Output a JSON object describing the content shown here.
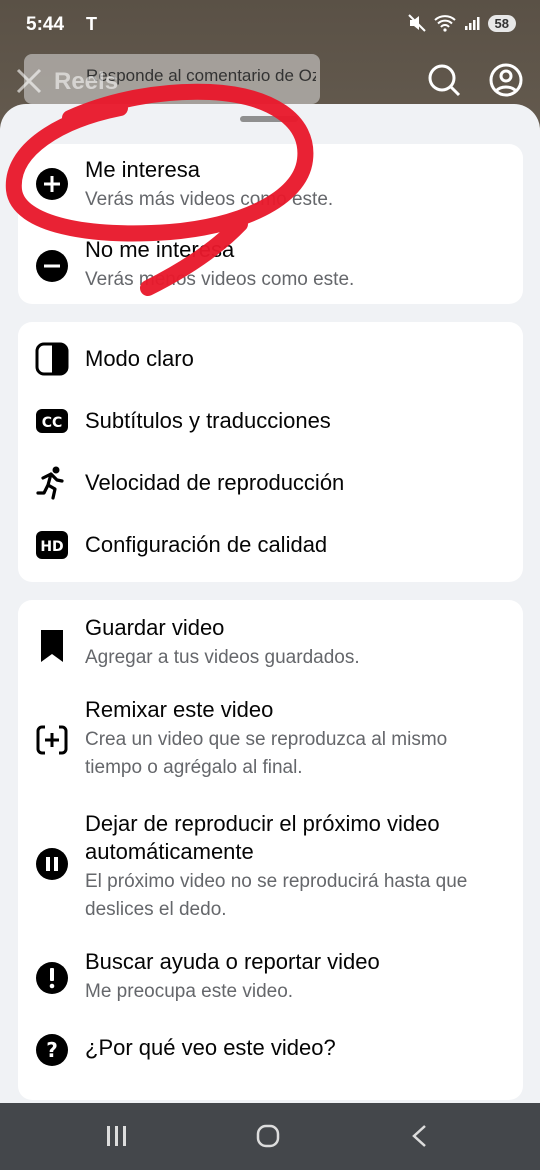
{
  "status": {
    "time": "5:44",
    "carrier_icon": "tesla-logo",
    "battery": "58"
  },
  "topbar": {
    "title": "Reels",
    "comment": "Responde al comentario de Ozcan Martinez"
  },
  "card1": [
    {
      "title": "Me interesa",
      "sub": "Verás más videos como este.",
      "icon": "plus-circle-icon"
    },
    {
      "title": "No me interesa",
      "sub": "Verás menos videos como este.",
      "icon": "minus-circle-icon"
    }
  ],
  "card2": [
    {
      "title": "Modo claro",
      "icon": "half-contrast-icon"
    },
    {
      "title": "Subtítulos y traducciones",
      "icon": "cc-icon"
    },
    {
      "title": "Velocidad de reproducción",
      "icon": "running-icon"
    },
    {
      "title": "Configuración de calidad",
      "icon": "hd-icon"
    }
  ],
  "card3": [
    {
      "title": "Guardar video",
      "sub": "Agregar a tus videos guardados.",
      "icon": "bookmark-icon"
    },
    {
      "title": "Remixar este video",
      "sub1": "Crea un video que se reproduzca al mismo",
      "sub2": "tiempo o agrégalo al final.",
      "icon": "remix-icon"
    },
    {
      "title1": "Dejar de reproducir el próximo video",
      "title2": "automáticamente",
      "sub1": "El próximo video no se reproducirá hasta que",
      "sub2": "deslices el dedo.",
      "icon": "pause-circle-icon"
    },
    {
      "title": "Buscar ayuda o reportar video",
      "sub": "Me preocupa este video.",
      "icon": "exclamation-circle-icon"
    },
    {
      "title": "¿Por qué veo este video?",
      "icon": "question-circle-icon"
    }
  ],
  "colors": {
    "accent_red": "#e8192c",
    "sheet_bg": "#f0f2f5",
    "card_bg": "#ffffff",
    "navbar": "#44474b"
  }
}
